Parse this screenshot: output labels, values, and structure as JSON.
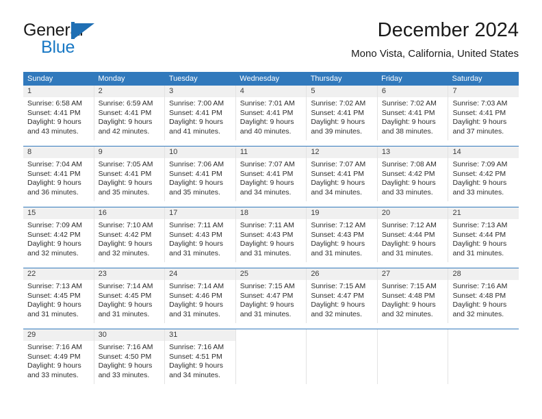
{
  "brand": {
    "word_one": "General",
    "word_two": "Blue",
    "accent_color": "#1878c4",
    "mark_color": "#1f6fb4"
  },
  "header": {
    "title": "December 2024",
    "subtitle": "Mono Vista, California, United States"
  },
  "calendar": {
    "header_bg": "#3179bc",
    "day_band_bg": "#f0f0f0",
    "weekday_headers": [
      "Sunday",
      "Monday",
      "Tuesday",
      "Wednesday",
      "Thursday",
      "Friday",
      "Saturday"
    ],
    "weeks": [
      [
        {
          "day": "1",
          "lines": [
            "Sunrise: 6:58 AM",
            "Sunset: 4:41 PM",
            "Daylight: 9 hours",
            "and 43 minutes."
          ]
        },
        {
          "day": "2",
          "lines": [
            "Sunrise: 6:59 AM",
            "Sunset: 4:41 PM",
            "Daylight: 9 hours",
            "and 42 minutes."
          ]
        },
        {
          "day": "3",
          "lines": [
            "Sunrise: 7:00 AM",
            "Sunset: 4:41 PM",
            "Daylight: 9 hours",
            "and 41 minutes."
          ]
        },
        {
          "day": "4",
          "lines": [
            "Sunrise: 7:01 AM",
            "Sunset: 4:41 PM",
            "Daylight: 9 hours",
            "and 40 minutes."
          ]
        },
        {
          "day": "5",
          "lines": [
            "Sunrise: 7:02 AM",
            "Sunset: 4:41 PM",
            "Daylight: 9 hours",
            "and 39 minutes."
          ]
        },
        {
          "day": "6",
          "lines": [
            "Sunrise: 7:02 AM",
            "Sunset: 4:41 PM",
            "Daylight: 9 hours",
            "and 38 minutes."
          ]
        },
        {
          "day": "7",
          "lines": [
            "Sunrise: 7:03 AM",
            "Sunset: 4:41 PM",
            "Daylight: 9 hours",
            "and 37 minutes."
          ]
        }
      ],
      [
        {
          "day": "8",
          "lines": [
            "Sunrise: 7:04 AM",
            "Sunset: 4:41 PM",
            "Daylight: 9 hours",
            "and 36 minutes."
          ]
        },
        {
          "day": "9",
          "lines": [
            "Sunrise: 7:05 AM",
            "Sunset: 4:41 PM",
            "Daylight: 9 hours",
            "and 35 minutes."
          ]
        },
        {
          "day": "10",
          "lines": [
            "Sunrise: 7:06 AM",
            "Sunset: 4:41 PM",
            "Daylight: 9 hours",
            "and 35 minutes."
          ]
        },
        {
          "day": "11",
          "lines": [
            "Sunrise: 7:07 AM",
            "Sunset: 4:41 PM",
            "Daylight: 9 hours",
            "and 34 minutes."
          ]
        },
        {
          "day": "12",
          "lines": [
            "Sunrise: 7:07 AM",
            "Sunset: 4:41 PM",
            "Daylight: 9 hours",
            "and 34 minutes."
          ]
        },
        {
          "day": "13",
          "lines": [
            "Sunrise: 7:08 AM",
            "Sunset: 4:42 PM",
            "Daylight: 9 hours",
            "and 33 minutes."
          ]
        },
        {
          "day": "14",
          "lines": [
            "Sunrise: 7:09 AM",
            "Sunset: 4:42 PM",
            "Daylight: 9 hours",
            "and 33 minutes."
          ]
        }
      ],
      [
        {
          "day": "15",
          "lines": [
            "Sunrise: 7:09 AM",
            "Sunset: 4:42 PM",
            "Daylight: 9 hours",
            "and 32 minutes."
          ]
        },
        {
          "day": "16",
          "lines": [
            "Sunrise: 7:10 AM",
            "Sunset: 4:42 PM",
            "Daylight: 9 hours",
            "and 32 minutes."
          ]
        },
        {
          "day": "17",
          "lines": [
            "Sunrise: 7:11 AM",
            "Sunset: 4:43 PM",
            "Daylight: 9 hours",
            "and 31 minutes."
          ]
        },
        {
          "day": "18",
          "lines": [
            "Sunrise: 7:11 AM",
            "Sunset: 4:43 PM",
            "Daylight: 9 hours",
            "and 31 minutes."
          ]
        },
        {
          "day": "19",
          "lines": [
            "Sunrise: 7:12 AM",
            "Sunset: 4:43 PM",
            "Daylight: 9 hours",
            "and 31 minutes."
          ]
        },
        {
          "day": "20",
          "lines": [
            "Sunrise: 7:12 AM",
            "Sunset: 4:44 PM",
            "Daylight: 9 hours",
            "and 31 minutes."
          ]
        },
        {
          "day": "21",
          "lines": [
            "Sunrise: 7:13 AM",
            "Sunset: 4:44 PM",
            "Daylight: 9 hours",
            "and 31 minutes."
          ]
        }
      ],
      [
        {
          "day": "22",
          "lines": [
            "Sunrise: 7:13 AM",
            "Sunset: 4:45 PM",
            "Daylight: 9 hours",
            "and 31 minutes."
          ]
        },
        {
          "day": "23",
          "lines": [
            "Sunrise: 7:14 AM",
            "Sunset: 4:45 PM",
            "Daylight: 9 hours",
            "and 31 minutes."
          ]
        },
        {
          "day": "24",
          "lines": [
            "Sunrise: 7:14 AM",
            "Sunset: 4:46 PM",
            "Daylight: 9 hours",
            "and 31 minutes."
          ]
        },
        {
          "day": "25",
          "lines": [
            "Sunrise: 7:15 AM",
            "Sunset: 4:47 PM",
            "Daylight: 9 hours",
            "and 31 minutes."
          ]
        },
        {
          "day": "26",
          "lines": [
            "Sunrise: 7:15 AM",
            "Sunset: 4:47 PM",
            "Daylight: 9 hours",
            "and 32 minutes."
          ]
        },
        {
          "day": "27",
          "lines": [
            "Sunrise: 7:15 AM",
            "Sunset: 4:48 PM",
            "Daylight: 9 hours",
            "and 32 minutes."
          ]
        },
        {
          "day": "28",
          "lines": [
            "Sunrise: 7:16 AM",
            "Sunset: 4:48 PM",
            "Daylight: 9 hours",
            "and 32 minutes."
          ]
        }
      ],
      [
        {
          "day": "29",
          "lines": [
            "Sunrise: 7:16 AM",
            "Sunset: 4:49 PM",
            "Daylight: 9 hours",
            "and 33 minutes."
          ]
        },
        {
          "day": "30",
          "lines": [
            "Sunrise: 7:16 AM",
            "Sunset: 4:50 PM",
            "Daylight: 9 hours",
            "and 33 minutes."
          ]
        },
        {
          "day": "31",
          "lines": [
            "Sunrise: 7:16 AM",
            "Sunset: 4:51 PM",
            "Daylight: 9 hours",
            "and 34 minutes."
          ]
        },
        {
          "day": "",
          "lines": []
        },
        {
          "day": "",
          "lines": []
        },
        {
          "day": "",
          "lines": []
        },
        {
          "day": "",
          "lines": []
        }
      ]
    ]
  }
}
